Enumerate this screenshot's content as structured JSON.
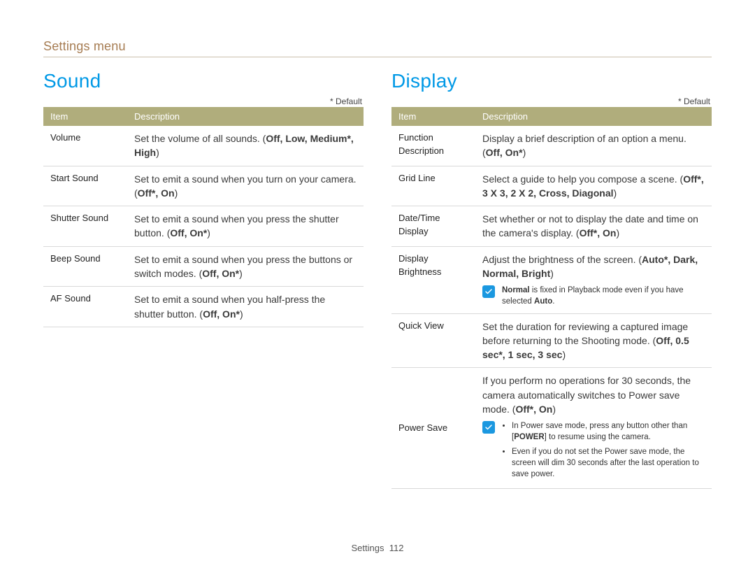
{
  "breadcrumb": "Settings menu",
  "default_marker": "* Default",
  "table_headers": {
    "item": "Item",
    "description": "Description"
  },
  "sound": {
    "title": "Sound",
    "rows": [
      {
        "item": "Volume",
        "desc_pre": "Set the volume of all sounds. (",
        "opts": "Off, Low, Medium*, High",
        "desc_post": ")"
      },
      {
        "item": "Start Sound",
        "desc_pre": "Set to emit a sound when you turn on your camera. (",
        "opts": "Off*, On",
        "desc_post": ")"
      },
      {
        "item": "Shutter Sound",
        "desc_pre": "Set to emit a sound when you press the shutter button. (",
        "opts": "Off, On*",
        "desc_post": ")"
      },
      {
        "item": "Beep Sound",
        "desc_pre": "Set to emit a sound when you press the buttons or switch modes. (",
        "opts": "Off, On*",
        "desc_post": ")"
      },
      {
        "item": "AF Sound",
        "desc_pre": "Set to emit a sound when you half-press the shutter button. (",
        "opts": "Off, On*",
        "desc_post": ")"
      }
    ]
  },
  "display": {
    "title": "Display",
    "rows": [
      {
        "item": "Function Description",
        "desc_pre": "Display a brief description of an option a menu. (",
        "opts": "Off, On*",
        "desc_post": ")"
      },
      {
        "item": "Grid Line",
        "desc_pre": "Select a guide to help you compose a scene. (",
        "opts": "Off*, 3 X 3, 2 X 2, Cross, Diagonal",
        "desc_post": ")"
      },
      {
        "item": "Date/Time Display",
        "desc_pre": "Set whether or not to display the date and time on the camera's display. (",
        "opts": "Off*, On",
        "desc_post": ")"
      },
      {
        "item": "Display Brightness",
        "desc_pre": "Adjust the brightness of the screen. (",
        "opts": "Auto*, Dark, Normal, Bright",
        "desc_post": ")",
        "note_single_pre": "Normal",
        "note_single_mid": " is fixed in Playback mode even if you have selected ",
        "note_single_post": "Auto",
        "note_single_tail": "."
      },
      {
        "item": "Quick View",
        "desc_pre": "Set the duration for reviewing a captured image before returning to the Shooting mode. (",
        "opts": "Off, 0.5 sec*, 1 sec, 3 sec",
        "desc_post": ")"
      },
      {
        "item": "Power Save",
        "desc_pre": "If you perform no operations for 30 seconds, the camera automatically switches to Power save mode. (",
        "opts": "Off*, On",
        "desc_post": ")",
        "note_bullets": [
          {
            "pre": "In Power save mode, press any button other than [",
            "mid": "POWER",
            "post": "] to resume using the camera."
          },
          {
            "pre": "Even if you do not set the Power save mode, the screen will dim 30 seconds after the last operation to save power.",
            "mid": "",
            "post": ""
          }
        ]
      }
    ]
  },
  "footer": {
    "label": "Settings",
    "page": "112"
  }
}
